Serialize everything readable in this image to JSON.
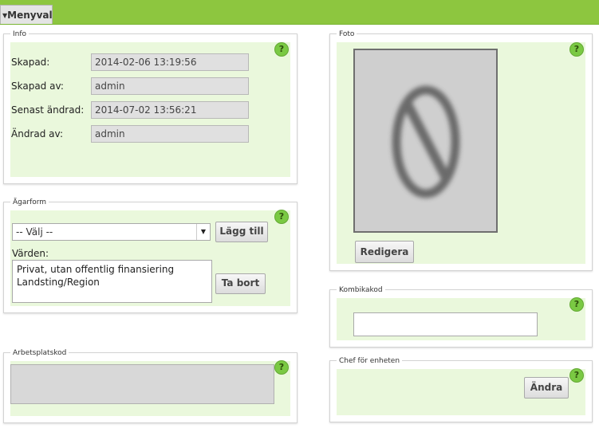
{
  "menu": {
    "label": "Menyval"
  },
  "info": {
    "legend": "Info",
    "created_label": "Skapad:",
    "created_value": "2014-02-06 13:19:56",
    "created_by_label": "Skapad av:",
    "created_by_value": "admin",
    "modified_label": "Senast ändrad:",
    "modified_value": "2014-07-02 13:56:21",
    "modified_by_label": "Ändrad av:",
    "modified_by_value": "admin"
  },
  "agarform": {
    "legend": "Ägarform",
    "select_value": "-- Välj --",
    "add_button": "Lägg till",
    "values_label": "Värden:",
    "values": [
      "Privat, utan offentlig finansiering",
      "Landsting/Region"
    ],
    "remove_button": "Ta bort"
  },
  "arbetsplatskod": {
    "legend": "Arbetsplatskod"
  },
  "foto": {
    "legend": "Foto",
    "edit_button": "Redigera"
  },
  "kombikakod": {
    "legend": "Kombikakod",
    "value": ""
  },
  "chef": {
    "legend": "Chef för enheten",
    "change_button": "Ändra"
  },
  "help": {
    "symbol": "?"
  },
  "colors": {
    "accent": "#8dc63f",
    "panel_bg": "#eaf8dc",
    "help_badge": "#7ac943"
  },
  "icons": {
    "help": "help-icon",
    "photo_placeholder": "no-photo-icon",
    "menu_arrow": "caret-down-icon"
  }
}
